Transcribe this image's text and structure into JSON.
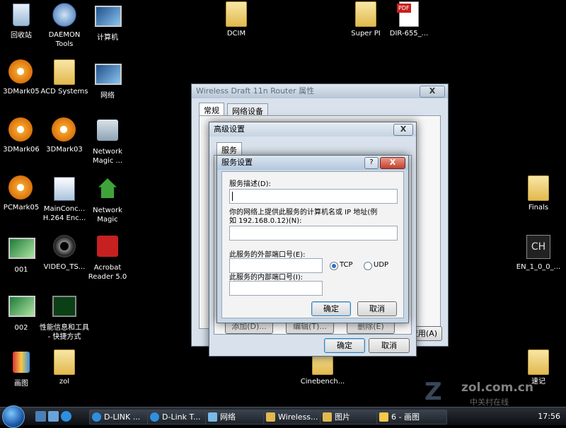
{
  "desktop": {
    "icons": [
      {
        "label": "回收站"
      },
      {
        "label": "DAEMON Tools"
      },
      {
        "label": "计算机"
      },
      {
        "label": "DCIM"
      },
      {
        "label": "Super PI"
      },
      {
        "label": "DIR-655_..."
      },
      {
        "label": "3DMark05"
      },
      {
        "label": "ACD Systems"
      },
      {
        "label": "网络"
      },
      {
        "label": "3DMark06"
      },
      {
        "label": "3DMark03"
      },
      {
        "label": "Network Magic ..."
      },
      {
        "label": "PCMark05"
      },
      {
        "label": "MainConc... H.264 Enc..."
      },
      {
        "label": "Network Magic"
      },
      {
        "label": "001"
      },
      {
        "label": "VIDEO_TS..."
      },
      {
        "label": "Acrobat Reader 5.0"
      },
      {
        "label": "002"
      },
      {
        "label": "性能信息和工具 - 快捷方式"
      },
      {
        "label": "画图"
      },
      {
        "label": "zol"
      },
      {
        "label": "Cinebench..."
      },
      {
        "label": "Finals"
      },
      {
        "label": "EN_1_0_0_..."
      },
      {
        "label": "速记"
      }
    ],
    "watermark": "ZOL.COM.CN 中关村在线"
  },
  "back_window": {
    "title": "Wireless Draft 11n Router 属性",
    "tabs": [
      "常规",
      "网络设备"
    ],
    "close": "X",
    "apply": "应用(A)"
  },
  "adv_window": {
    "title": "高级设置",
    "tab": "服务",
    "ok": "确定",
    "cancel": "取消",
    "close": "X",
    "hidden_buttons": [
      "添加(D)...",
      "编辑(T)...",
      "删除(E)"
    ]
  },
  "service_dialog": {
    "title": "服务设置",
    "help": "?",
    "close": "X",
    "desc_label": "服务描述(D):",
    "desc_value": "",
    "host_label_1": "你的网络上提供此服务的计算机名或 IP 地址(例",
    "host_label_2": "如 192.168.0.12)(N):",
    "host_value": "",
    "ext_port_label": "此服务的外部端口号(E):",
    "ext_port_value": "",
    "int_port_label": "此服务的内部端口号(I):",
    "int_port_value": "",
    "tcp": "TCP",
    "udp": "UDP",
    "protocol_selected": "TCP",
    "ok": "确定",
    "cancel": "取消"
  },
  "taskbar": {
    "tasks": [
      "D-LINK ...",
      "D-Link T...",
      "网络",
      "Wireless...",
      "图片",
      "6 - 画图"
    ],
    "clock": "17:56"
  }
}
